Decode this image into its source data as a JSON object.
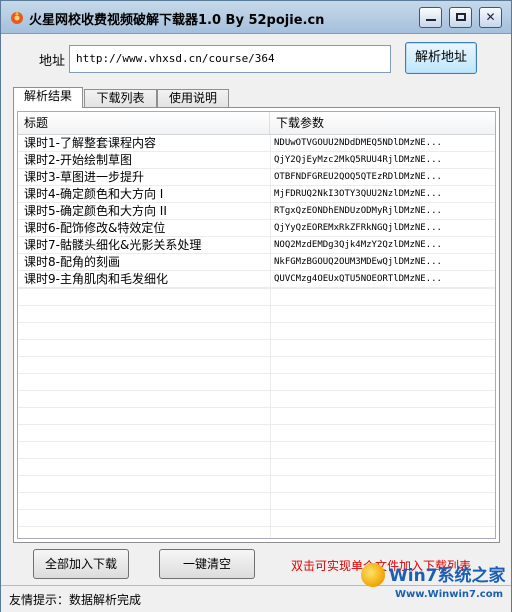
{
  "window": {
    "title": "火星网校收费视频破解下载器1.0 By 52pojie.cn",
    "close_glyph": "✕"
  },
  "address": {
    "label": "地址",
    "value": "http://www.vhxsd.cn/course/364",
    "parse_button": "解析地址"
  },
  "tabs": [
    {
      "label": "解析结果",
      "active": true
    },
    {
      "label": "下载列表",
      "active": false
    },
    {
      "label": "使用说明",
      "active": false
    }
  ],
  "table": {
    "columns": [
      "标题",
      "下载参数"
    ],
    "rows": [
      {
        "title": "课时1-了解整套课程内容",
        "param": "NDUwOTVGOUU2NDdDMEQ5NDlDMzNE..."
      },
      {
        "title": "课时2-开始绘制草图",
        "param": "QjY2QjEyMzc2MkQ5RUU4RjlDMzNE..."
      },
      {
        "title": "课时3-草图进一步提升",
        "param": "OTBFNDFGREU2QOQ5QTEzRDlDMzNE..."
      },
      {
        "title": "课时4-确定颜色和大方向 I",
        "param": "MjFDRUQ2NkI3OTY3QUU2NzlDMzNE..."
      },
      {
        "title": "课时5-确定颜色和大方向 II",
        "param": "RTgxQzEONDhENDUzODMyRjlDMzNE..."
      },
      {
        "title": "课时6-配饰修改&特效定位",
        "param": "QjYyQzEOREMxRkZFRkNGQjlDMzNE..."
      },
      {
        "title": "课时7-骷髅头细化&光影关系处理",
        "param": "NOQ2MzdEMDg3Qjk4MzY2QzlDMzNE..."
      },
      {
        "title": "课时8-配角的刻画",
        "param": "NkFGMzBGOUQ2OUM3MDEwQjlDMzNE..."
      },
      {
        "title": "课时9-主角肌肉和毛发细化",
        "param": "QUVCMzg4OEUxQTU5NOEORTlDMzNE..."
      }
    ]
  },
  "buttons": {
    "add_all": "全部加入下载",
    "clear": "一键清空"
  },
  "hint": "双击可实现单个文件加入下载列表",
  "status": "友情提示：数据解析完成",
  "watermark": {
    "brand": "Win7系统之家",
    "site": "Www.Winwin7.com"
  }
}
